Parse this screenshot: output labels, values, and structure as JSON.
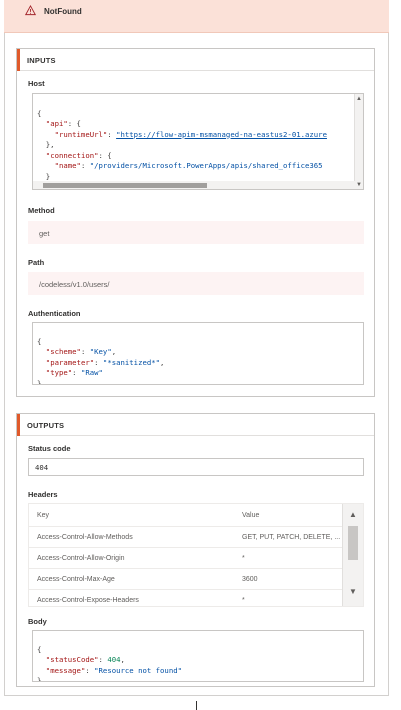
{
  "header": {
    "title": "NotFound",
    "icon": "warning-icon"
  },
  "inputs": {
    "section_label": "INPUTS",
    "host": {
      "label": "Host",
      "lines": [
        "{",
        "  \"api\": {",
        "    \"runtimeUrl\": \"https://flow-apim-msmanaged-na-eastus2-01.azure",
        "  },",
        "  \"connection\": {",
        "    \"name\": \"/providers/Microsoft.PowerApps/apis/shared_office365",
        "  }",
        "}"
      ]
    },
    "method": {
      "label": "Method",
      "value": "get"
    },
    "path": {
      "label": "Path",
      "value": "/codeless/v1.0/users/"
    },
    "authentication": {
      "label": "Authentication",
      "lines": [
        "{",
        "  \"scheme\": \"Key\",",
        "  \"parameter\": \"*sanitized*\",",
        "  \"type\": \"Raw\"",
        "}"
      ]
    }
  },
  "outputs": {
    "section_label": "OUTPUTS",
    "status_code": {
      "label": "Status code",
      "value": "404"
    },
    "headers": {
      "label": "Headers",
      "columns": [
        "Key",
        "Value"
      ],
      "rows": [
        {
          "key": "Access-Control-Allow-Methods",
          "value": "GET, PUT, PATCH, DELETE, ..."
        },
        {
          "key": "Access-Control-Allow-Origin",
          "value": "*"
        },
        {
          "key": "Access-Control-Max-Age",
          "value": "3600"
        },
        {
          "key": "Access-Control-Expose-Headers",
          "value": "*"
        }
      ]
    },
    "body": {
      "label": "Body",
      "lines": [
        "{",
        "  \"statusCode\": 404,",
        "  \"message\": \"Resource not found\"",
        "}"
      ]
    }
  },
  "colors": {
    "header_bg": "#fbe1d8",
    "accent": "#e05a2b",
    "field_bg": "#fdf3f3"
  }
}
